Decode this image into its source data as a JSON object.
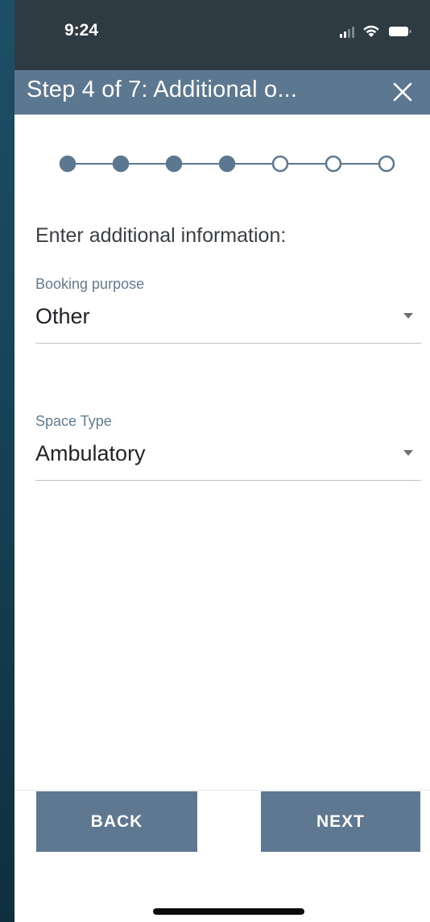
{
  "status_bar": {
    "time": "9:24",
    "icons": [
      "cellular-signal-icon",
      "wifi-icon",
      "battery-icon"
    ]
  },
  "header": {
    "title": "Step 4 of 7: Additional o...",
    "close_icon": "close-icon"
  },
  "stepper": {
    "current_step": 4,
    "total_steps": 7,
    "completed_color": "#5c7890",
    "pending_color": "#ffffff"
  },
  "form": {
    "instructions": "Enter additional information:",
    "booking_purpose": {
      "label": "Booking purpose",
      "value": "Other"
    },
    "space_type": {
      "label": "Space Type",
      "value": "Ambulatory"
    }
  },
  "footer": {
    "back_label": "BACK",
    "next_label": "NEXT"
  },
  "colors": {
    "header_bg": "#5c7890",
    "button_bg": "#5d7890",
    "label_color": "#5f7c93"
  }
}
